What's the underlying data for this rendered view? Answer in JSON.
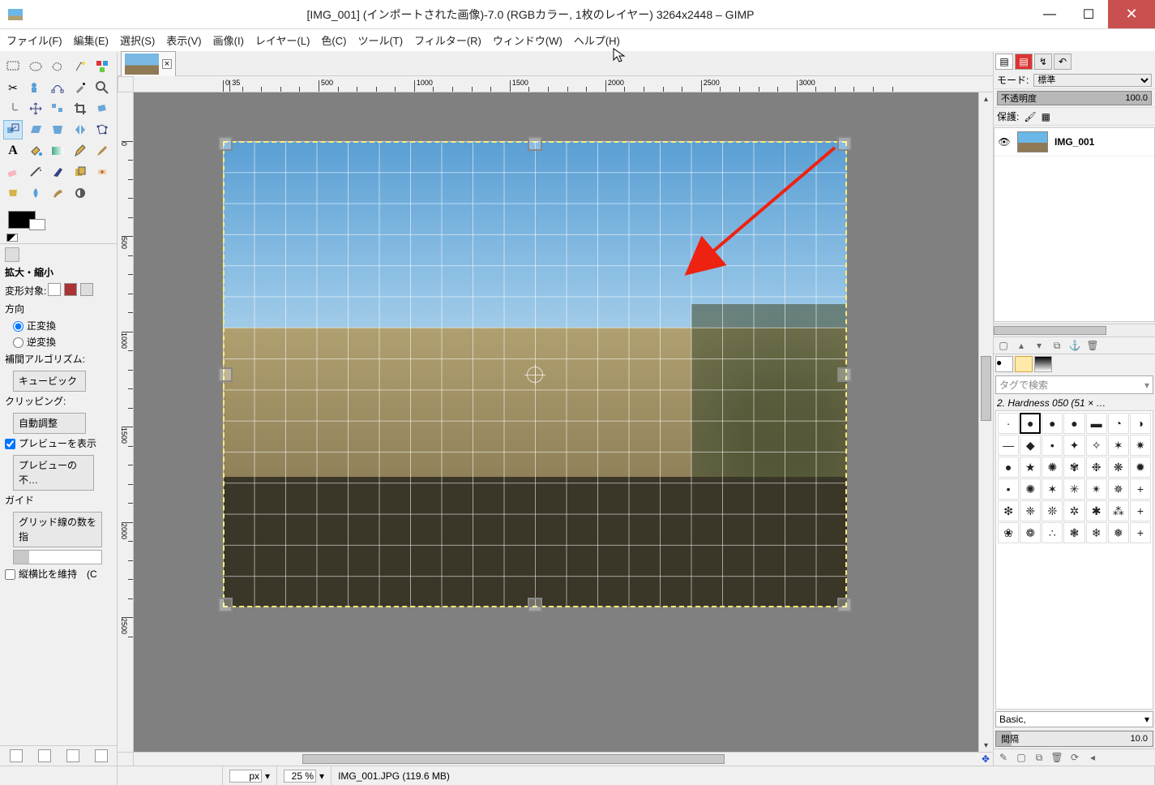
{
  "window": {
    "title": "[IMG_001] (インポートされた画像)-7.0 (RGBカラー, 1枚のレイヤー) 3264x2448 – GIMP"
  },
  "menu": {
    "file": "ファイル(F)",
    "edit": "編集(E)",
    "select": "選択(S)",
    "view": "表示(V)",
    "image": "画像(I)",
    "layer": "レイヤー(L)",
    "color": "色(C)",
    "tools": "ツール(T)",
    "filter": "フィルター(R)",
    "window": "ウィンドウ(W)",
    "help": "ヘルプ(H)"
  },
  "tooloptions": {
    "title": "拡大・縮小",
    "transform_target_label": "変形対象:",
    "direction_label": "方向",
    "forward": "正変換",
    "backward": "逆変換",
    "interp_label": "補間アルゴリズム:",
    "interp_value": "キュービック",
    "clip_label": "クリッピング:",
    "clip_value": "自動調整",
    "show_preview": "プレビューを表示",
    "preview_opacity": "プレビューの不…",
    "guides_label": "ガイド",
    "guides_value": "グリッド線の数を指",
    "keep_aspect": "縦横比を維持　(C"
  },
  "ruler": {
    "h_ticks": [
      "0",
      "500",
      "1000",
      "1500",
      "2000",
      "2500",
      "3000",
      "35"
    ],
    "v_ticks": [
      "0",
      "500",
      "1000",
      "1500",
      "2000",
      "2500"
    ]
  },
  "right": {
    "mode_label": "モード:",
    "mode_value": "標準",
    "opacity_label": "不透明度",
    "opacity_value": "100.0",
    "protect_label": "保護:",
    "layer_name": "IMG_001",
    "tag_placeholder": "タグで検索",
    "brush_name": "2. Hardness 050 (51 × …",
    "set_name": "Basic,",
    "spacing_label": "間隔",
    "spacing_value": "10.0"
  },
  "status": {
    "unit": "px",
    "zoom": "25 %",
    "file_info": "IMG_001.JPG (119.6 MB)"
  }
}
